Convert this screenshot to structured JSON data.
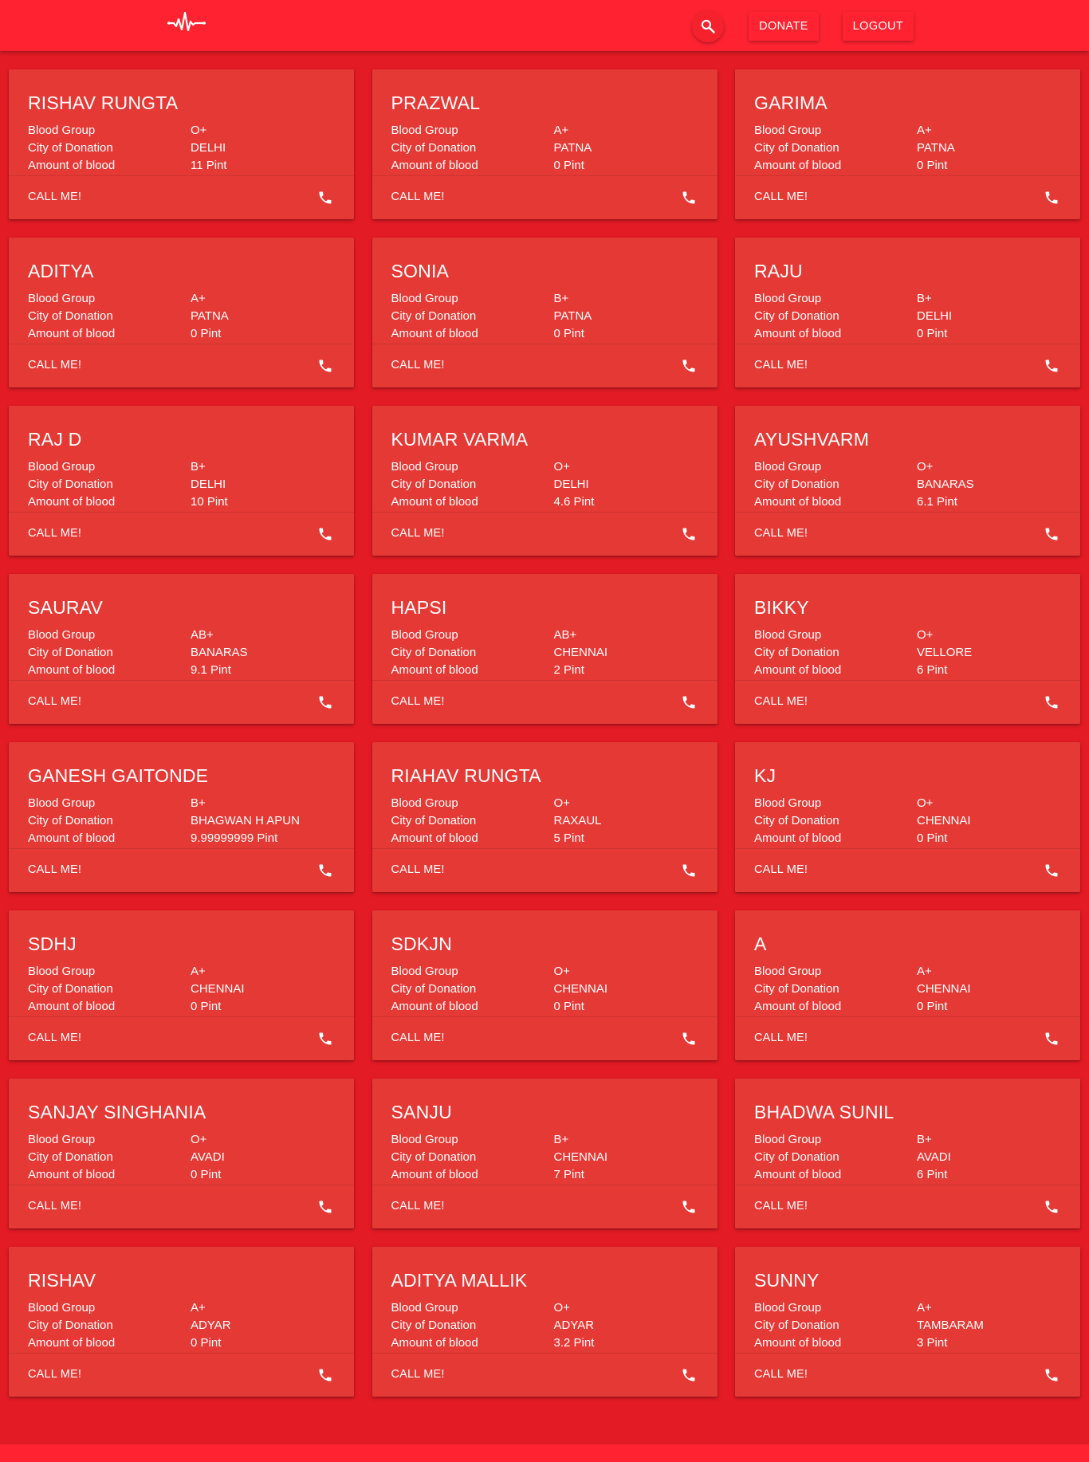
{
  "header": {
    "logo_icon": "heartbeat-pulse-icon",
    "search_icon": "search-icon",
    "donate_label": "DONATE",
    "logout_label": "LOGOUT"
  },
  "colors": {
    "topbar": "#ff2331",
    "page_background": "#e31b25",
    "card": "#e53935"
  },
  "labels": {
    "blood_group": "Blood Group",
    "city": "City of Donation",
    "amount": "Amount of blood",
    "call": "CALL ME!",
    "call_icon": "phone-icon"
  },
  "donors": [
    {
      "name": "RISHAV RUNGTA",
      "blood_group": "O+",
      "city": "DELHI",
      "amount": "11 Pint"
    },
    {
      "name": "PRAZWAL",
      "blood_group": "A+",
      "city": "PATNA",
      "amount": "0 Pint"
    },
    {
      "name": "GARIMA",
      "blood_group": "A+",
      "city": "PATNA",
      "amount": "0 Pint"
    },
    {
      "name": "ADITYA",
      "blood_group": "A+",
      "city": "PATNA",
      "amount": "0 Pint"
    },
    {
      "name": "SONIA",
      "blood_group": "B+",
      "city": "PATNA",
      "amount": "0 Pint"
    },
    {
      "name": "RAJU",
      "blood_group": "B+",
      "city": "DELHI",
      "amount": "0 Pint"
    },
    {
      "name": "RAJ D",
      "blood_group": "B+",
      "city": "DELHI",
      "amount": "10 Pint"
    },
    {
      "name": "KUMAR VARMA",
      "blood_group": "O+",
      "city": "DELHI",
      "amount": "4.6 Pint"
    },
    {
      "name": "AYUSHVARM",
      "blood_group": "O+",
      "city": "BANARAS",
      "amount": "6.1 Pint"
    },
    {
      "name": "SAURAV",
      "blood_group": "AB+",
      "city": "BANARAS",
      "amount": "9.1 Pint"
    },
    {
      "name": "HAPSI",
      "blood_group": "AB+",
      "city": "CHENNAI",
      "amount": "2 Pint"
    },
    {
      "name": "BIKKY",
      "blood_group": "O+",
      "city": "VELLORE",
      "amount": "6 Pint"
    },
    {
      "name": "GANESH GAITONDE",
      "blood_group": "B+",
      "city": "BHAGWAN H APUN",
      "amount": "9.99999999 Pint"
    },
    {
      "name": "RIAHAV RUNGTA",
      "blood_group": "O+",
      "city": "RAXAUL",
      "amount": "5 Pint"
    },
    {
      "name": "KJ",
      "blood_group": "O+",
      "city": "CHENNAI",
      "amount": "0 Pint"
    },
    {
      "name": "SDHJ",
      "blood_group": "A+",
      "city": "CHENNAI",
      "amount": "0 Pint"
    },
    {
      "name": "SDKJN",
      "blood_group": "O+",
      "city": "CHENNAI",
      "amount": "0 Pint"
    },
    {
      "name": "A",
      "blood_group": "A+",
      "city": "CHENNAI",
      "amount": "0 Pint"
    },
    {
      "name": "SANJAY SINGHANIA",
      "blood_group": "O+",
      "city": "AVADI",
      "amount": "0 Pint"
    },
    {
      "name": "SANJU",
      "blood_group": "B+",
      "city": "CHENNAI",
      "amount": "7 Pint"
    },
    {
      "name": "BHADWA SUNIL",
      "blood_group": "B+",
      "city": "AVADI",
      "amount": "6 Pint"
    },
    {
      "name": "RISHAV",
      "blood_group": "A+",
      "city": "ADYAR",
      "amount": "0 Pint"
    },
    {
      "name": "ADITYA MALLIK",
      "blood_group": "O+",
      "city": "ADYAR",
      "amount": "3.2 Pint"
    },
    {
      "name": "SUNNY",
      "blood_group": "A+",
      "city": "TAMBARAM",
      "amount": "3 Pint"
    }
  ]
}
